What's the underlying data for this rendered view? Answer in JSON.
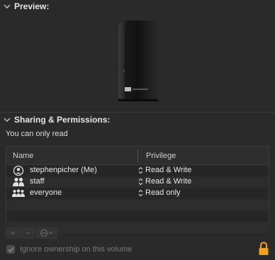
{
  "preview": {
    "header": "Preview:"
  },
  "sharing": {
    "header": "Sharing & Permissions:",
    "access_note": "You can only read",
    "columns": {
      "name": "Name",
      "privilege": "Privilege"
    },
    "rows": [
      {
        "name": "stephenpicher (Me)",
        "privilege": "Read & Write",
        "icon": "user-icon"
      },
      {
        "name": "staff",
        "privilege": "Read & Write",
        "icon": "group-icon"
      },
      {
        "name": "everyone",
        "privilege": "Read only",
        "icon": "everyone-icon"
      }
    ]
  },
  "toolbar": {
    "add": "+",
    "remove": "−"
  },
  "ignore_ownership": {
    "label": "Ignore ownership on this volume",
    "checked": true
  },
  "colors": {
    "background": "#2a2a2a",
    "lock": "#f0a020"
  }
}
